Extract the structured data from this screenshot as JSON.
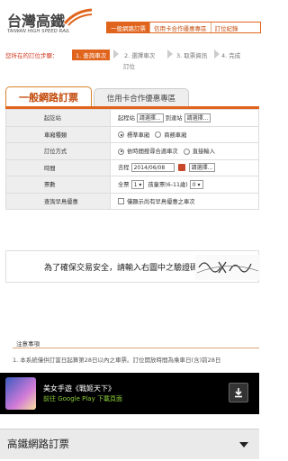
{
  "header": {
    "logo_zh": "台灣高鐵",
    "logo_en": "TAIWAN HIGH SPEED RAIL",
    "nav": [
      "一般網路訂票",
      "信用卡合作優惠專區",
      "訂位紀錄"
    ]
  },
  "steps": {
    "label": "您所在的訂位步驟：",
    "items": [
      "1. 查詢車次",
      "2. 選擇車次",
      "3. 取票資訊",
      "4. 完成",
      "訂位"
    ]
  },
  "tabs": [
    "一般網路訂票",
    "信用卡合作優惠專區"
  ],
  "form": {
    "station": {
      "label": "起訖站",
      "from_label": "起程站",
      "from_value": "請選擇...",
      "to_label": "到達站",
      "to_value": "請選擇..."
    },
    "car_type": {
      "label": "車廂種類",
      "options": [
        "標準車廂",
        "商務車廂"
      ],
      "selected": 0
    },
    "booking_method": {
      "label": "訂位方式",
      "options": [
        "依時間搜尋合適車次",
        "直接輸入"
      ],
      "selected": 0
    },
    "time": {
      "label": "時間",
      "prefix": "去程",
      "date": "2014/06/08",
      "time_value": "請選擇..."
    },
    "tickets": {
      "label": "票數",
      "adult_label": "全票",
      "adult_value": "1",
      "child_label": "孩童票(6-11歲)",
      "child_value": "0"
    },
    "early_bird": {
      "label": "查詢早鳥優惠",
      "checkbox_label": "僅顯示尚有早鳥優惠之車次"
    }
  },
  "captcha": {
    "prompt": "為了確保交易安全，請輸入右圖中之驗證碼："
  },
  "notice": {
    "title": "注意事項",
    "text": "1. 本系統僅供訂當日起算第28日以內之車票。訂位開放時間為乘車日(含)前28日"
  },
  "ad": {
    "title": "美女手遊《戰姬天下》",
    "subtitle": "前往 Google Play 下載頁面"
  },
  "bottom": {
    "label": "高鐵網路訂票"
  }
}
